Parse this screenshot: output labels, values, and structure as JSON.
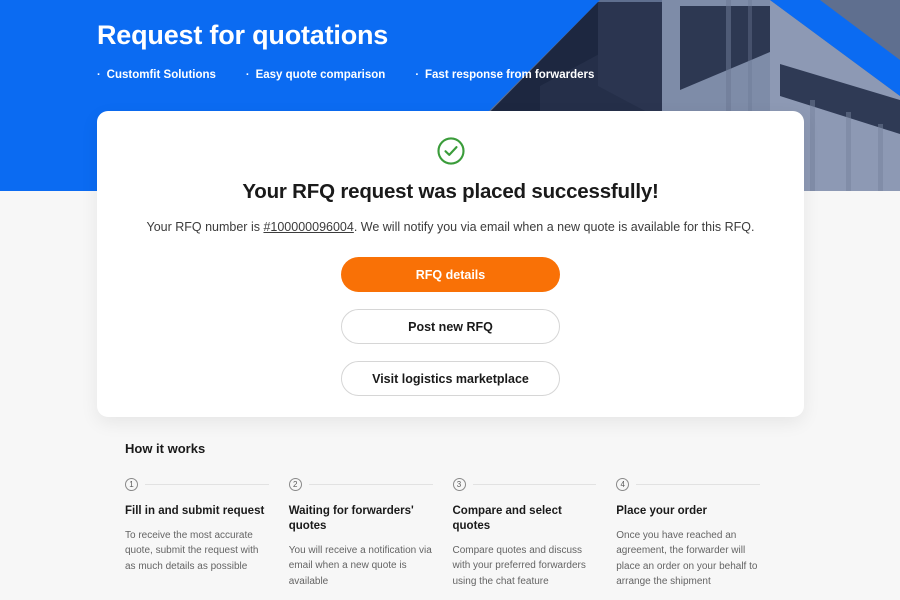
{
  "hero": {
    "title": "Request for quotations",
    "bullets": [
      {
        "label": "Customfit Solutions"
      },
      {
        "label": "Easy quote comparison"
      },
      {
        "label": "Fast response from forwarders"
      }
    ],
    "background_color": "#0b6bf2"
  },
  "card": {
    "status_icon": "check-circle-icon",
    "status_icon_color": "#3a9c3a",
    "title": "Your RFQ request was placed successfully!",
    "subtitle_prefix": "Your RFQ number is ",
    "rfq_number": "#100000096004",
    "subtitle_suffix": ". We will notify you via email when a new quote is available for this RFQ.",
    "buttons": [
      {
        "label": "RFQ details",
        "style": "primary",
        "color": "#f97106"
      },
      {
        "label": "Post new RFQ",
        "style": "outline"
      },
      {
        "label": "Visit logistics marketplace",
        "style": "outline"
      }
    ]
  },
  "how_it_works": {
    "title": "How it works",
    "steps": [
      {
        "number": "1",
        "name": "Fill in and submit request",
        "description": "To receive the most accurate quote, submit the request with as much details as possible"
      },
      {
        "number": "2",
        "name": "Waiting for forwarders' quotes",
        "description": "You will receive a notification via email when a new quote is available"
      },
      {
        "number": "3",
        "name": "Compare and select quotes",
        "description": "Compare quotes and discuss with your preferred forwarders using the chat feature"
      },
      {
        "number": "4",
        "name": "Place your order",
        "description": "Once you have reached an agreement, the forwarder will place an order on your behalf to arrange the shipment"
      }
    ]
  }
}
